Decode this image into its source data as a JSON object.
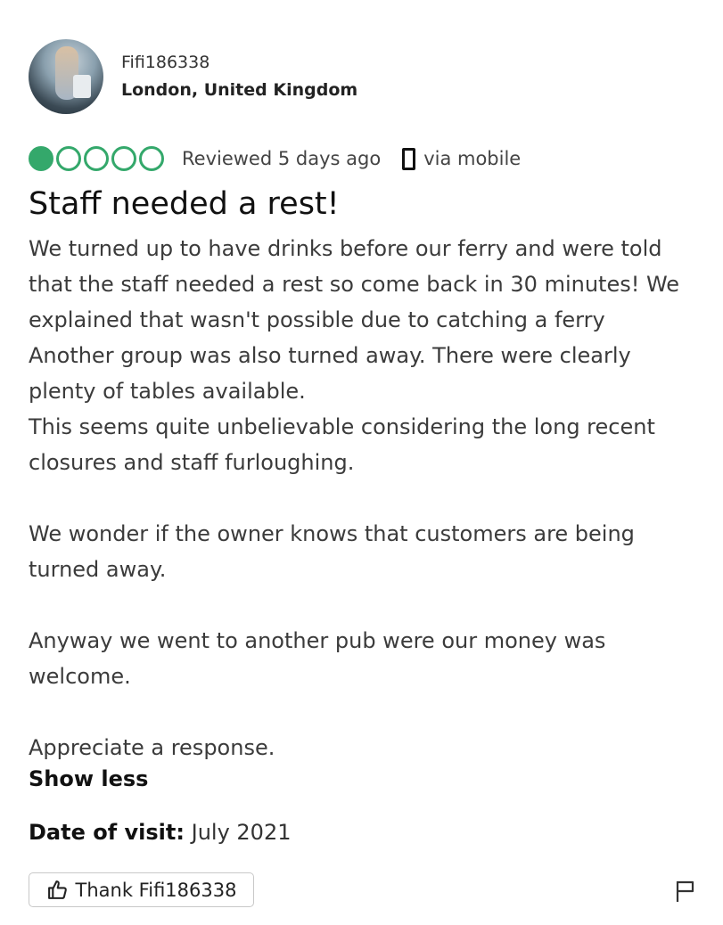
{
  "reviewer": {
    "username": "Fifi186338",
    "location": "London, United Kingdom"
  },
  "review": {
    "rating": 1,
    "rating_max": 5,
    "reviewed": "Reviewed 5 days ago",
    "via": "via mobile",
    "title": "Staff needed a rest!",
    "body_lines": [
      "We turned up to have drinks before our ferry and were told",
      "that the staff needed a rest so come back in 30 minutes! We",
      "explained that wasn't possible due to catching a ferry",
      "Another group was also turned away. There were clearly",
      "plenty of tables available.",
      "This seems quite unbelievable considering the long recent",
      "closures and staff furloughing.",
      "",
      "We wonder if the owner knows that customers are being",
      "turned away.",
      "",
      "Anyway we went to another pub were our money was",
      "welcome.",
      "",
      "Appreciate a response."
    ],
    "show_less": "Show less",
    "date_of_visit_label": "Date of visit:",
    "date_of_visit_value": "July 2021",
    "thank_button": "Thank Fifi186338"
  },
  "icons": {
    "rating": "bubble-rating-icon",
    "mobile": "mobile-phone-icon",
    "thumb": "thumbs-up-icon",
    "flag": "flag-icon"
  },
  "colors": {
    "rating_green": "#34a86b",
    "text": "#111111"
  }
}
